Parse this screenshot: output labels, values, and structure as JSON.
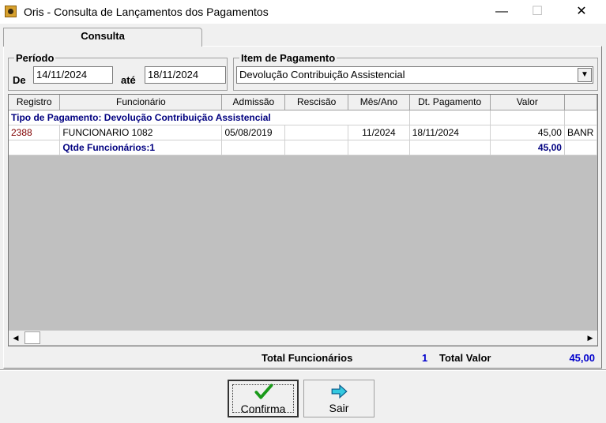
{
  "window": {
    "title": "Oris - Consulta de Lançamentos dos Pagamentos"
  },
  "tabs": [
    {
      "label": "Consulta",
      "active": true
    }
  ],
  "periodo": {
    "title": "Período",
    "from_label": "De",
    "from_value": "14/11/2024",
    "to_label": "até",
    "to_value": "18/11/2024"
  },
  "item_pagamento": {
    "title": "Item de Pagamento",
    "selected": "Devolução Contribuição Assistencial"
  },
  "grid": {
    "columns": [
      "Registro",
      "Funcionário",
      "Admissão",
      "Rescisão",
      "Mês/Ano",
      "Dt. Pagamento",
      "Valor",
      ""
    ],
    "group_header": "Tipo de Pagamento: Devolução Contribuição Assistencial",
    "rows": [
      {
        "registro": "2388",
        "funcionario": "FUNCIONARIO 1082",
        "admissao": "05/08/2019",
        "rescisao": "",
        "mes_ano": "11/2024",
        "dt_pagamento": "18/11/2024",
        "valor": "45,00",
        "extra": "BANR"
      }
    ],
    "group_footer": {
      "label": "Qtde Funcionários:1",
      "valor": "45,00"
    }
  },
  "totals": {
    "func_label": "Total Funcionários",
    "func_value": "1",
    "valor_label": "Total Valor",
    "valor_value": "45,00"
  },
  "buttons": {
    "confirma": "Confirma",
    "sair": "Sair"
  },
  "colors": {
    "group_text": "#000080",
    "registro_text": "#800000",
    "total_value": "#0000cc",
    "grid_empty": "#c0c0c0"
  },
  "icons": {
    "confirma": "checkmark-icon",
    "sair": "arrow-right-icon"
  }
}
